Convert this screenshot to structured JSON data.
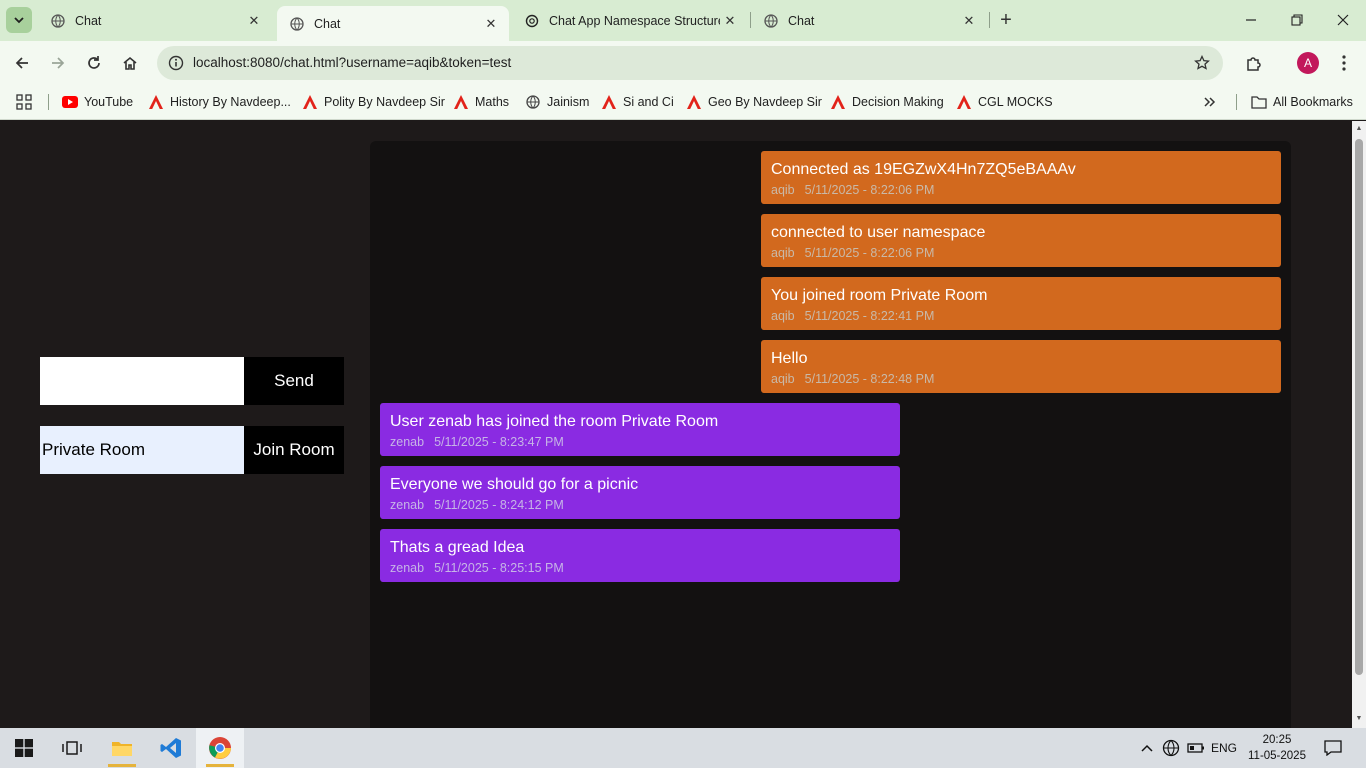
{
  "browser": {
    "tabs": [
      {
        "title": "Chat",
        "active": false
      },
      {
        "title": "Chat",
        "active": true
      },
      {
        "title": "Chat App Namespace Structure",
        "active": false
      },
      {
        "title": "Chat",
        "active": false
      }
    ],
    "url": "localhost:8080/chat.html?username=aqib&token=test",
    "profile_initial": "A",
    "bookmarks": [
      {
        "label": "YouTube",
        "icon": "youtube-icon"
      },
      {
        "label": "History By Navdeep...",
        "icon": "red-a-icon"
      },
      {
        "label": "Polity By Navdeep Sir",
        "icon": "red-a-icon"
      },
      {
        "label": "Maths",
        "icon": "red-a-icon"
      },
      {
        "label": "Jainism",
        "icon": "globe-icon"
      },
      {
        "label": "Si and Ci",
        "icon": "red-a-icon"
      },
      {
        "label": "Geo By Navdeep Sir",
        "icon": "red-a-icon"
      },
      {
        "label": "Decision Making",
        "icon": "red-a-icon"
      },
      {
        "label": "CGL MOCKS",
        "icon": "red-a-icon"
      }
    ],
    "all_bookmarks_label": "All Bookmarks"
  },
  "chat": {
    "message_input_value": "",
    "send_label": "Send",
    "room_input_value": "Private Room",
    "join_label": "Join Room",
    "messages": [
      {
        "text": "Connected as 19EGZwX4Hn7ZQ5eBAAAv",
        "user": "aqib",
        "time": "5/11/2025 - 8:22:06 PM",
        "self": true
      },
      {
        "text": "connected to user namespace",
        "user": "aqib",
        "time": "5/11/2025 - 8:22:06 PM",
        "self": true
      },
      {
        "text": "You joined room Private Room",
        "user": "aqib",
        "time": "5/11/2025 - 8:22:41 PM",
        "self": true
      },
      {
        "text": "Hello",
        "user": "aqib",
        "time": "5/11/2025 - 8:22:48 PM",
        "self": true
      },
      {
        "text": "User zenab has joined the room Private Room",
        "user": "zenab",
        "time": "5/11/2025 - 8:23:47 PM",
        "self": false
      },
      {
        "text": "Everyone we should go for a picnic",
        "user": "zenab",
        "time": "5/11/2025 - 8:24:12 PM",
        "self": false
      },
      {
        "text": "Thats a gread Idea",
        "user": "zenab",
        "time": "5/11/2025 - 8:25:15 PM",
        "self": false
      }
    ],
    "colors": {
      "self_bubble": "#d2691e",
      "other_bubble": "#8a2be2",
      "panel": "#131111"
    }
  },
  "taskbar": {
    "language": "ENG",
    "time": "20:25",
    "date": "11-05-2025"
  }
}
